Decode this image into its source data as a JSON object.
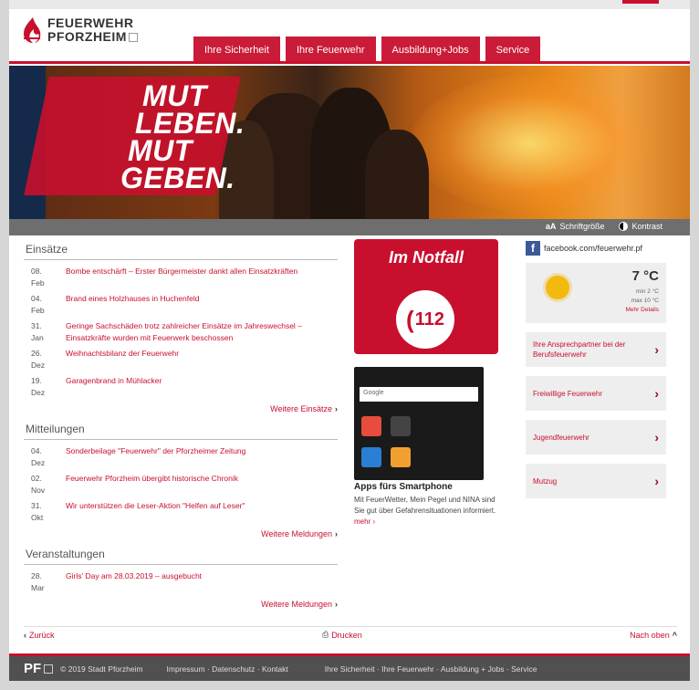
{
  "header": {
    "logo_line1": "FEUERWEHR",
    "logo_line2": "PFORZHEIM",
    "nav": [
      "Ihre Sicherheit",
      "Ihre Feuerwehr",
      "Ausbildung+Jobs",
      "Service"
    ]
  },
  "hero": {
    "slogan": [
      "MUT",
      "LEBEN.",
      "MUT",
      "GEBEN."
    ]
  },
  "utility": {
    "font_size": "Schriftgröße",
    "contrast": "Kontrast"
  },
  "einsaetze": {
    "heading": "Einsätze",
    "items": [
      {
        "date": "08. Feb",
        "text": "Bombe entschärft – Erster Bürgermeister dankt allen Einsatzkräften"
      },
      {
        "date": "04. Feb",
        "text": "Brand eines Holzhauses in Huchenfeld"
      },
      {
        "date": "31. Jan",
        "text": "Geringe Sachschäden trotz zahlreicher Einsätze im Jahreswechsel – Einsatzkräfte wurden mit Feuerwerk beschossen"
      },
      {
        "date": "26. Dez",
        "text": "Weihnachtsbilanz der Feuerwehr"
      },
      {
        "date": "19. Dez",
        "text": "Garagenbrand in Mühlacker"
      }
    ],
    "more": "Weitere Einsätze"
  },
  "mitteilungen": {
    "heading": "Mitteilungen",
    "items": [
      {
        "date": "04. Dez",
        "text": "Sonderbeilage \"Feuerwehr\" der Pforzheimer Zeitung"
      },
      {
        "date": "02. Nov",
        "text": "Feuerwehr Pforzheim übergibt historische Chronik"
      },
      {
        "date": "31. Okt",
        "text": "Wir unterstützen die Leser-Aktion \"Helfen auf Leser\""
      }
    ],
    "more": "Weitere Meldungen"
  },
  "veranstaltungen": {
    "heading": "Veranstaltungen",
    "items": [
      {
        "date": "28. Mar",
        "text": "Girls' Day am 28.03.2019 – ausgebucht"
      }
    ],
    "more": "Weitere Meldungen"
  },
  "notfall": {
    "title": "Im Notfall",
    "number": "112"
  },
  "apps": {
    "search_placeholder": "Google",
    "title": "Apps fürs Smartphone",
    "text": "Mit FeuerWetter, Mein Pegel und NINA sind Sie gut über Gefahrensituationen informiert.",
    "more": "mehr"
  },
  "social": {
    "facebook": "facebook.com/feuerwehr.pf"
  },
  "weather": {
    "temp": "7 °C",
    "line1": "min 2 °C",
    "line2": "max 10 °C",
    "line3": "Mehr Details"
  },
  "links": [
    {
      "label": "Ihre Ansprechpartner bei der Berufsfeuerwehr"
    },
    {
      "label": "Freiwillige Feuerwehr"
    },
    {
      "label": "Jugendfeuerwehr"
    },
    {
      "label": "Mutzug"
    }
  ],
  "footer_nav": {
    "back": "Zurück",
    "print": "Drucken",
    "top": "Nach oben"
  },
  "footer": {
    "pf": "PF",
    "copyright": "© 2019 Stadt Pforzheim",
    "links_left": "Impressum · Datenschutz · Kontakt",
    "links_right": "Ihre Sicherheit · Ihre Feuerwehr · Ausbildung + Jobs · Service"
  },
  "colors": {
    "brand_red": "#c8102e",
    "footer_gray": "#505050"
  }
}
